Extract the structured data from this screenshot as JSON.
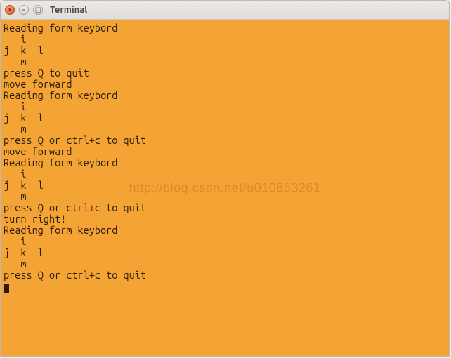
{
  "window": {
    "title": "Terminal",
    "close_glyph": "×",
    "min_glyph": "−",
    "max_glyph": "□"
  },
  "terminal": {
    "lines": [
      "Reading form keybord",
      "   i",
      "j  k  l",
      "   m",
      "press Q to quit",
      "move forward",
      "Reading form keybord",
      "   i",
      "j  k  l",
      "   m",
      "press Q or ctrl+c to quit",
      "move forward",
      "Reading form keybord",
      "   i",
      "j  k  l",
      "   m",
      "press Q or ctrl+c to quit",
      "turn right!",
      "Reading form keybord",
      "   i",
      "j  k  l",
      "   m",
      "press Q or ctrl+c to quit"
    ]
  },
  "watermark": "http://blog.csdn.net/u010853261"
}
